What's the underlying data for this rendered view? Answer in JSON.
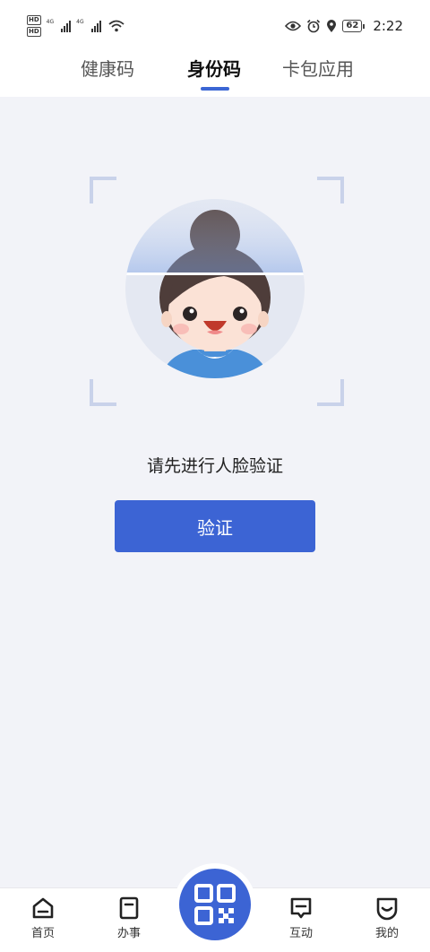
{
  "status_bar": {
    "hd_badges": [
      "HD",
      "HD"
    ],
    "network_labels": [
      "4G",
      "4G"
    ],
    "battery": "62",
    "time": "2:22"
  },
  "tabs": [
    {
      "label": "健康码",
      "active": false
    },
    {
      "label": "身份码",
      "active": true
    },
    {
      "label": "卡包应用",
      "active": false
    }
  ],
  "main": {
    "prompt": "请先进行人脸验证",
    "verify_button": "验证"
  },
  "bottom_nav": [
    {
      "label": "首页",
      "icon": "home-icon"
    },
    {
      "label": "办事",
      "icon": "document-icon"
    },
    {
      "label": "互动",
      "icon": "chat-icon"
    },
    {
      "label": "我的",
      "icon": "smile-icon"
    }
  ],
  "center_button": {
    "icon": "qr-code-icon"
  },
  "colors": {
    "accent": "#3c64d4",
    "background": "#f2f3f8",
    "frame": "#c9d2ea"
  }
}
